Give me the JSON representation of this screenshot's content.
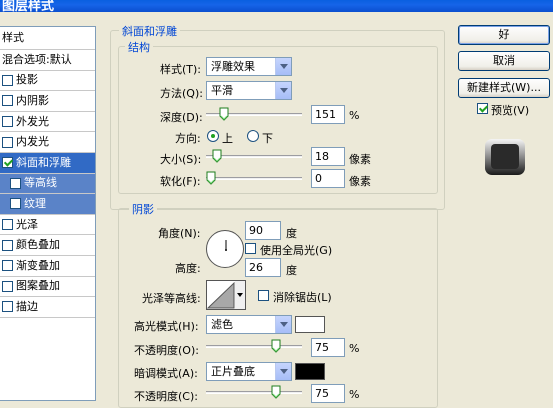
{
  "window": {
    "title": "图层样式"
  },
  "styles_list": {
    "header": "样式",
    "blend_options": "混合选项:默认",
    "items": [
      {
        "label": "投影",
        "checked": false
      },
      {
        "label": "内阴影",
        "checked": false
      },
      {
        "label": "外发光",
        "checked": false
      },
      {
        "label": "内发光",
        "checked": false
      },
      {
        "label": "斜面和浮雕",
        "checked": true,
        "selected": true
      },
      {
        "label": "等高线",
        "checked": false,
        "sub": true
      },
      {
        "label": "纹理",
        "checked": false,
        "sub": true
      },
      {
        "label": "光泽",
        "checked": false
      },
      {
        "label": "颜色叠加",
        "checked": false
      },
      {
        "label": "渐变叠加",
        "checked": false
      },
      {
        "label": "图案叠加",
        "checked": false
      },
      {
        "label": "描边",
        "checked": false
      }
    ]
  },
  "bevel": {
    "title": "斜面和浮雕",
    "structure": {
      "title": "结构",
      "style_label": "样式(T):",
      "style_value": "浮雕效果",
      "technique_label": "方法(Q):",
      "technique_value": "平滑",
      "depth_label": "深度(D):",
      "depth_value": "151",
      "depth_unit": "%",
      "depth_level": 0.15,
      "direction_label": "方向:",
      "direction_up": "上",
      "direction_down": "下",
      "size_label": "大小(S):",
      "size_value": "18",
      "size_unit": "像素",
      "size_level": 0.07,
      "soften_label": "软化(F):",
      "soften_value": "0",
      "soften_unit": "像素",
      "soften_level": 0
    },
    "shading": {
      "title": "阴影",
      "angle_label": "角度(N):",
      "angle_value": "90",
      "angle_unit": "度",
      "global_light_label": "使用全局光(G)",
      "altitude_label": "高度:",
      "altitude_value": "26",
      "altitude_unit": "度",
      "gloss_contour_label": "光泽等高线:",
      "antialias_label": "消除锯齿(L)",
      "highlight_mode_label": "高光模式(H):",
      "highlight_mode_value": "滤色",
      "highlight_color": "#ffffff",
      "highlight_opacity_label": "不透明度(O):",
      "highlight_opacity_value": "75",
      "highlight_opacity_unit": "%",
      "highlight_opacity_level": 0.75,
      "shadow_mode_label": "暗调模式(A):",
      "shadow_mode_value": "正片叠底",
      "shadow_color": "#000000",
      "shadow_opacity_label": "不透明度(C):",
      "shadow_opacity_value": "75",
      "shadow_opacity_unit": "%",
      "shadow_opacity_level": 0.75
    }
  },
  "buttons": {
    "ok": "好",
    "cancel": "取消",
    "new_style": "新建样式(W)...",
    "preview": "预览(V)"
  }
}
